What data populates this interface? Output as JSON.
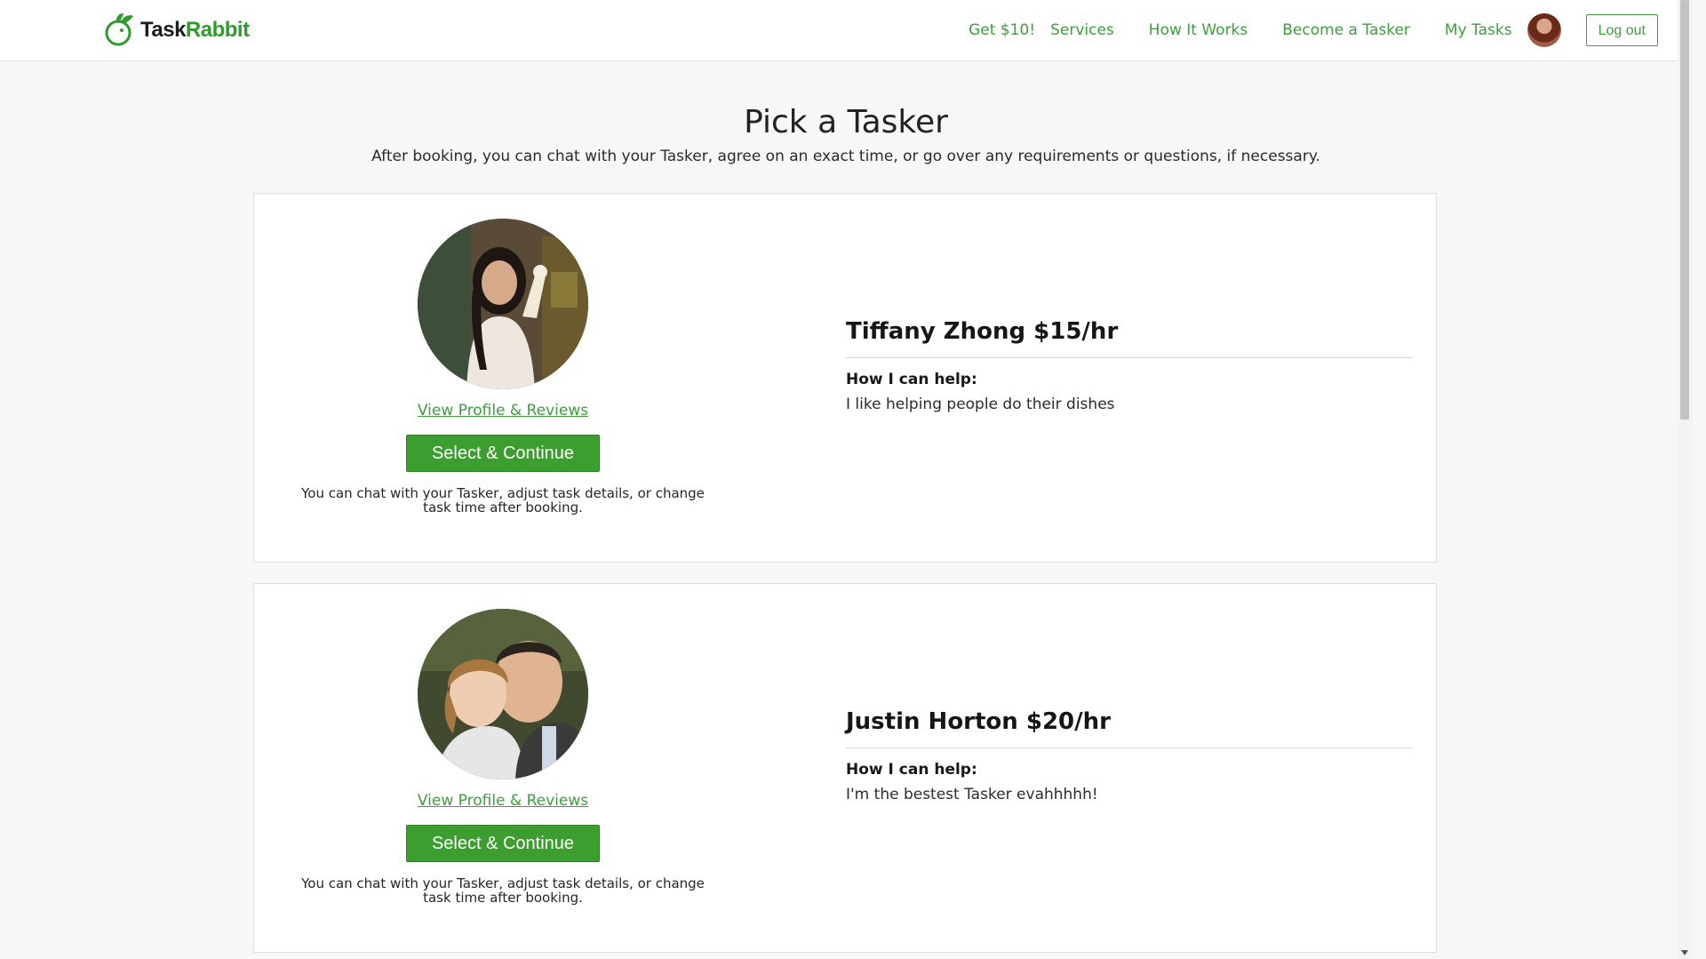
{
  "header": {
    "logo_task": "Task",
    "logo_rabbit": "Rabbit",
    "nav": {
      "get10": "Get $10!",
      "services": "Services",
      "how_it_works": "How It Works",
      "become_tasker": "Become a Tasker",
      "my_tasks": "My Tasks",
      "logout": "Log out"
    }
  },
  "main": {
    "title": "Pick a Tasker",
    "subtitle": "After booking, you can chat with your Tasker, agree on an exact time, or go over any requirements or questions, if necessary."
  },
  "taskers": [
    {
      "name_rate": "Tiffany Zhong $15/hr",
      "help_label": "How I can help:",
      "help_text": "I like helping people do their dishes",
      "profile_link": "View Profile & Reviews",
      "select_label": "Select & Continue",
      "note": "You can chat with your Tasker, adjust task details, or change task time after booking."
    },
    {
      "name_rate": "Justin Horton $20/hr",
      "help_label": "How I can help:",
      "help_text": "I'm the bestest Tasker evahhhhh!",
      "profile_link": "View Profile & Reviews",
      "select_label": "Select & Continue",
      "note": "You can chat with your Tasker, adjust task details, or change task time after booking."
    }
  ],
  "colors": {
    "brand_green": "#3f9d3c",
    "button_green": "#3b9e2e"
  }
}
